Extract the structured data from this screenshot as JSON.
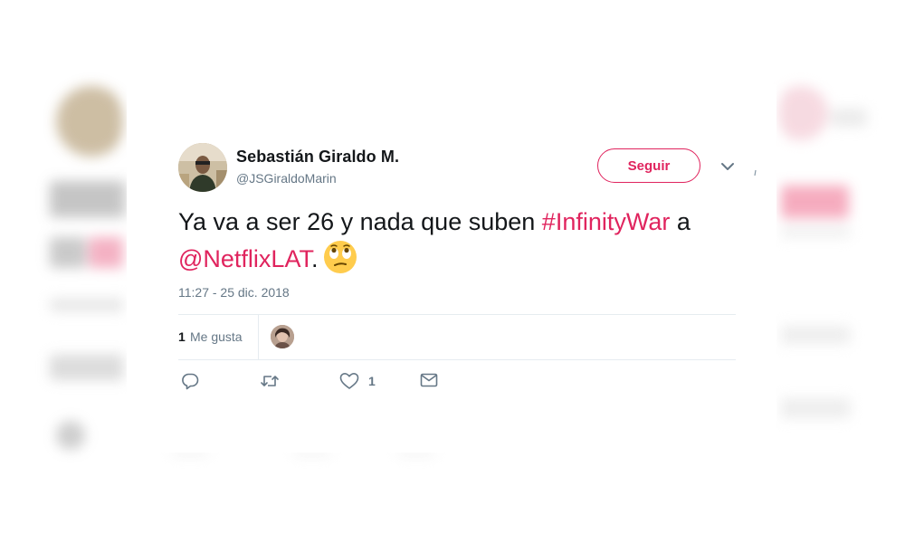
{
  "tweet": {
    "author": {
      "display_name": "Sebastián Giraldo M.",
      "handle": "@JSGiraldoMarin"
    },
    "follow_label": "Seguir",
    "text": {
      "part1": "Ya va a ser 26 y nada que suben ",
      "hashtag": "#InfinityWar",
      "part2": " a ",
      "mention": "@NetflixLAT",
      "part3": ".",
      "emoji": "face-with-rolling-eyes"
    },
    "timestamp": "11:27 - 25 dic. 2018",
    "likes": {
      "count": "1",
      "label": "Me gusta"
    },
    "actions": {
      "reply_icon": "reply-icon",
      "retweet_icon": "retweet-icon",
      "like_icon": "heart-icon",
      "like_count": "1",
      "dm_icon": "envelope-icon"
    },
    "colors": {
      "accent": "#e0245e",
      "text": "#14171a",
      "secondary": "#657786",
      "divider": "#e6ecf0"
    }
  }
}
